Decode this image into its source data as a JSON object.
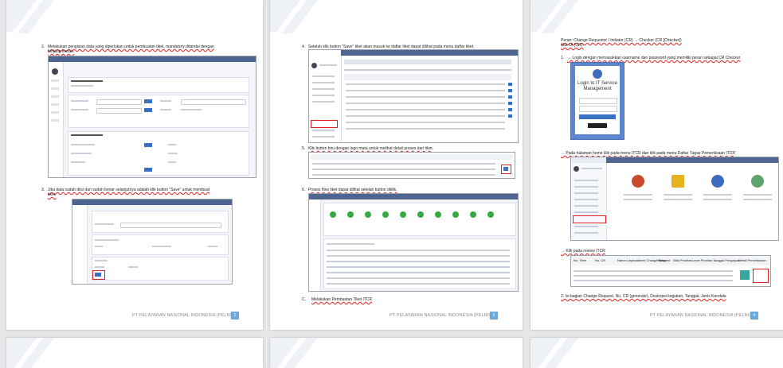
{
  "pages": {
    "p1": {
      "step2_num": "2.",
      "step2_line1": "Melakukan pengisian data yang diperlukan untuk pembuatan tiket, mandatory ditandai dengan",
      "step2_line2": "bintang merah.",
      "step3_num": "3.",
      "step3_line1": "Jika data sudah diisi dan sudah benar selanjutnya adalah klik button \"Save\" untuk membuat",
      "step3_line2": "tiket.",
      "footer": "PT PELAYARAN NASIONAL INDONESIA (PELNI)",
      "page_number": "2"
    },
    "p2": {
      "step4_num": "4.",
      "step4_text": "Setelah klik button \"Save\" tiket akan masuk ke daftar tiket dapat dilihat pada menu daftar tiket.",
      "step5_num": "5.",
      "step5_text": "Klik button biru dengan logo mata untuk melihat detail proses dari tiket.",
      "step6_num": "6.",
      "step6_text": "Proses flow tiket dapat dilihat setelah button diklik.",
      "stepC_num": "C.",
      "stepC_text": "Melakukan Pembuatan Tiket ITCR",
      "footer": "PT PELAYARAN NASIONAL INDONESIA (PELNI)",
      "page_number": "3"
    },
    "p3": {
      "role_line": "Peran: Change Requestor / Initiator (CR) → Checker (CR [Checker])",
      "by_line": "Alur UI (CR):",
      "step1_num": "1.",
      "step1_text": "→ Login dengan memasukkan username dan password yang memiliki peran sebagai CR Checker",
      "login_title_1": "Login to IT Service",
      "login_title_2": "Management",
      "step_home": "→ Pada halaman home klik pada menu ITCR dan klik pada menu Daftar Tugas Pemeriksaan ITCR",
      "step_review": "→ Klik pada review ITCR",
      "table_headers": [
        "No. Tiket",
        "No. CR",
        "Nama Layanan",
        "Jenis Change Request",
        "Status",
        "Nilai Prioritas",
        "Level Prioritas",
        "Tanggal Pengajuan",
        "Detail Pemeriksaan"
      ],
      "step2_text": "2. Isi bagian Change Request, No. CR (generate), Deskripsi kegiatan, Tanggal, Jenis Kendala",
      "footer": "PT PELAYARAN NASIONAL INDONESIA (PELNI)",
      "page_number": "4"
    }
  },
  "colors": {
    "page_number_bg": "#6ea9dc",
    "app_header": "#4f6591",
    "highlight": "#dd2222",
    "primary_button": "#3b6fc4"
  },
  "icons": [
    "corner-decoration-icon",
    "user-avatar-icon",
    "menu-icon",
    "eye-icon",
    "login-logo-icon",
    "settings-gear-icon",
    "alert-icon",
    "service-icon"
  ]
}
